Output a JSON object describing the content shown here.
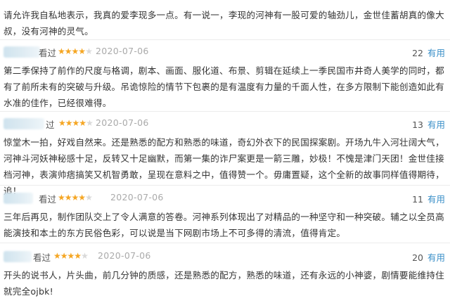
{
  "intro_text": "请允许我自私地表示，我真的爱李现多一点。有一说一，李现的河神有一股可爱的轴劲儿，金世佳蓄胡真的像大叔，没有河神的灵气。",
  "reviews": [
    {
      "action": "看过",
      "rating": 4,
      "date": "2020-07-06",
      "useful_count": "22",
      "useful_label": "有用",
      "text": "第二季保持了前作的尺度与格调，剧本、画面、服化道、布景、剪辑在延续上一季民国市井奇人美学的同时，都有了前所未有的突破与升级。吊诡惊险的情节下包裹的是有温度有力量的千面人性，在多方限制下能创造如此有水准的佳作，已经很难得。"
    },
    {
      "action": "过",
      "rating": 4,
      "date": "2020-07-06",
      "useful_count": "13",
      "useful_label": "有用",
      "text": "惊堂木一拍，好戏自然来。还是熟悉的配方和熟悉的味道，奇幻外衣下的民国探案剧。开场九牛入河壮阔大气，河神斗河妖神秘感十足，反转又十足幽默，而第一集的诈尸案更是一箭三雕，妙极！不愧是津门天团！金世佳接档河神，表演帅痞搞笑又机智勇敢，呈现在意料之中，值得赞一个。毋庸置疑，这个全新的故事同样值得期待，追！"
    },
    {
      "action": "看过",
      "rating": 4,
      "date": "2020-07-06",
      "useful_count": "11",
      "useful_label": "有用",
      "text": "三年后再见，制作团队交上了令人满意的答卷。河神系列体现出了对精品的一种坚守和一种突破。辅之以全员高能演技和本土的东方民俗色彩，可以说是当下网剧市场上不可多得的清流，值得肯定。"
    },
    {
      "action": "看过",
      "rating": 4,
      "date": "2020-07-06",
      "useful_count": "20",
      "useful_label": "有用",
      "text": "开头的说书人，片头曲，前几分钟的质感，还是熟悉的配方，熟悉的味道，还有永远的小神婆，剧情要能维持住就完全ojbk!"
    }
  ],
  "colors": {
    "star_active": "#f5a623",
    "star_inactive": "#d9d9d9",
    "date": "#aaaaaa",
    "useful_label": "#3a8fc8",
    "text": "#333333",
    "divider": "#ececec"
  }
}
